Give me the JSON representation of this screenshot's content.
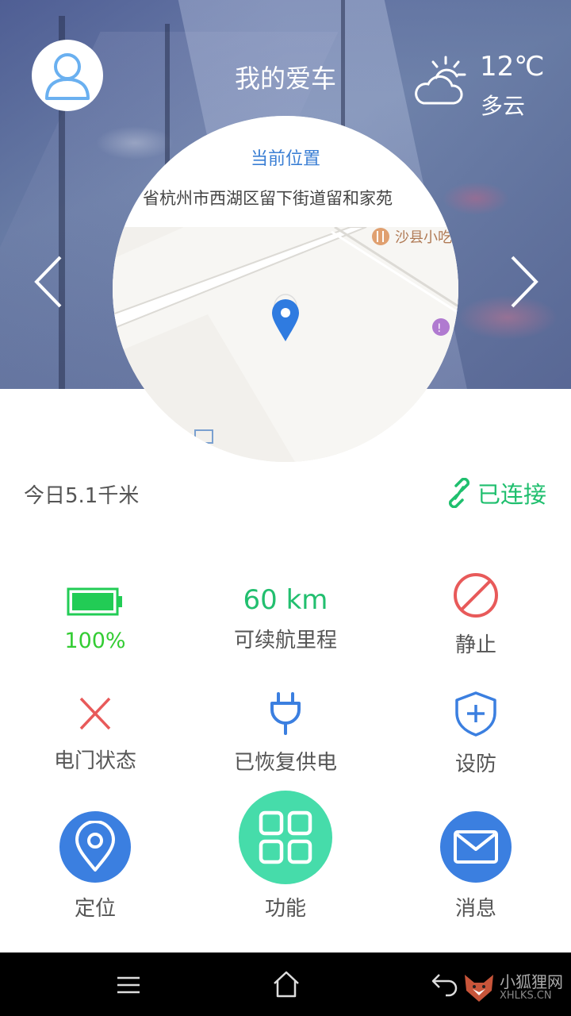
{
  "header": {
    "title": "我的爱车",
    "weather": {
      "temperature": "12℃",
      "condition": "多云"
    }
  },
  "location": {
    "title": "当前位置",
    "address": "省杭州市西湖区留下街道留和家苑",
    "poi_label": "沙县小吃"
  },
  "trip": {
    "today": "今日5.1千米"
  },
  "connection": {
    "status": "已连接"
  },
  "status_grid": {
    "battery": {
      "value": "100%"
    },
    "range": {
      "value": "60 km",
      "label": "可续航里程"
    },
    "motion": {
      "label": "静止"
    },
    "door": {
      "label": "电门状态"
    },
    "power": {
      "label": "已恢复供电"
    },
    "defense": {
      "label": "设防"
    }
  },
  "actions": {
    "locate": "定位",
    "functions": "功能",
    "messages": "消息"
  },
  "watermark": {
    "brand": "小狐狸网",
    "domain": "XHLKS.CN"
  },
  "colors": {
    "accent_blue": "#3b7fd4",
    "green": "#22bf6f",
    "teal": "#46dcaa",
    "red": "#e85a5a"
  }
}
